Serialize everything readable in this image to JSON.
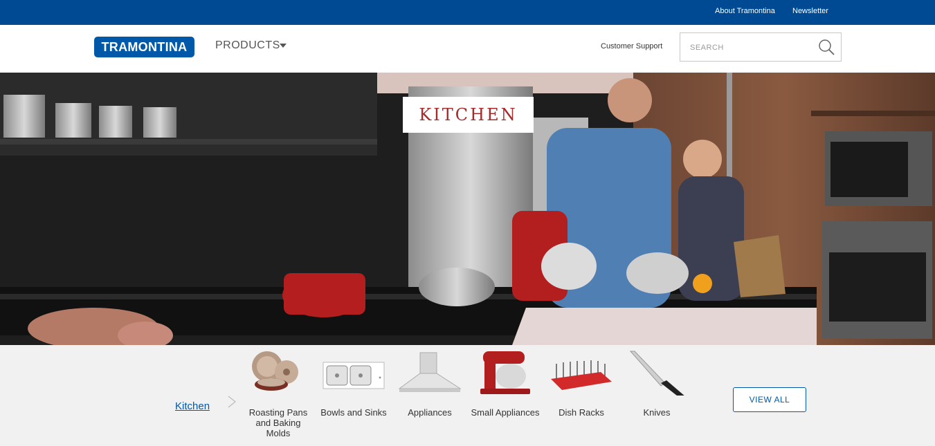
{
  "topbar": {
    "about_label": "About Tramontina",
    "newsletter_label": "Newsletter"
  },
  "header": {
    "logo_text": "TRAMONTINA",
    "products_label": "PRODUCTS",
    "support_label": "Customer Support",
    "search_placeholder": "SEARCH"
  },
  "hero": {
    "title": "KITCHEN"
  },
  "categories": {
    "section_label": "Kitchen",
    "items": [
      {
        "label": "Roasting Pans and Baking Molds",
        "icon": "baking-molds-icon"
      },
      {
        "label": "Bowls and Sinks",
        "icon": "sink-icon"
      },
      {
        "label": "Appliances",
        "icon": "range-hood-icon"
      },
      {
        "label": "Small Appliances",
        "icon": "stand-mixer-icon"
      },
      {
        "label": "Dish Racks",
        "icon": "dish-rack-icon"
      },
      {
        "label": "Knives",
        "icon": "knife-icon"
      }
    ],
    "view_all_label": "VIEW ALL"
  },
  "colors": {
    "brand_blue": "#004a93",
    "accent_red": "#a52a2a"
  }
}
